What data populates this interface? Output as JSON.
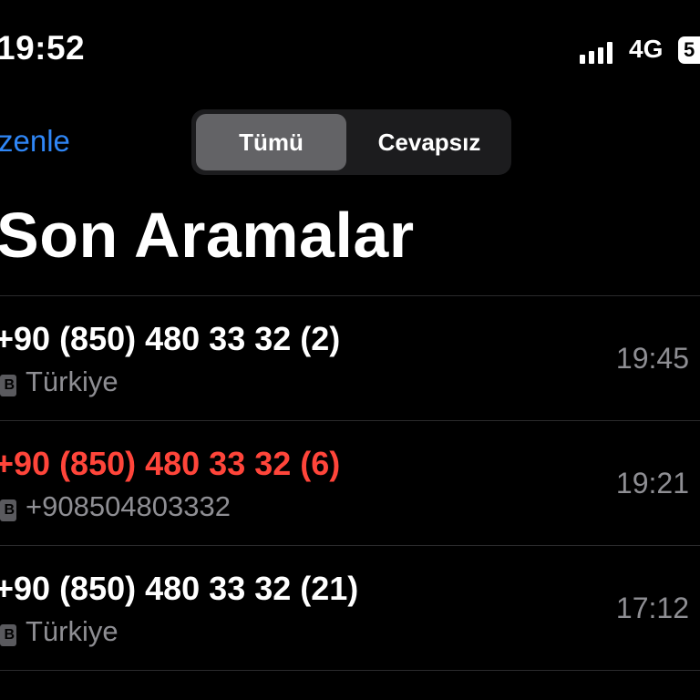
{
  "status_bar": {
    "time": "19:52",
    "network": "4G",
    "battery": "5"
  },
  "nav": {
    "edit_label": "zenle",
    "segments": [
      {
        "label": "Tümü",
        "selected": true
      },
      {
        "label": "Cevapsız",
        "selected": false
      }
    ]
  },
  "title": "Son Aramalar",
  "calls": [
    {
      "number": "+90 (850) 480 33 32 (2)",
      "sim": "B",
      "subtitle": "Türkiye",
      "time": "19:45",
      "missed": false
    },
    {
      "number": "+90 (850) 480 33 32 (6)",
      "sim": "B",
      "subtitle": "+908504803332",
      "time": "19:21",
      "missed": true
    },
    {
      "number": "+90 (850) 480 33 32 (21)",
      "sim": "B",
      "subtitle": "Türkiye",
      "time": "17:12",
      "missed": false
    }
  ],
  "colors": {
    "accent": "#2f86f6",
    "missed": "#ff453a",
    "secondary": "#8e8e93"
  }
}
